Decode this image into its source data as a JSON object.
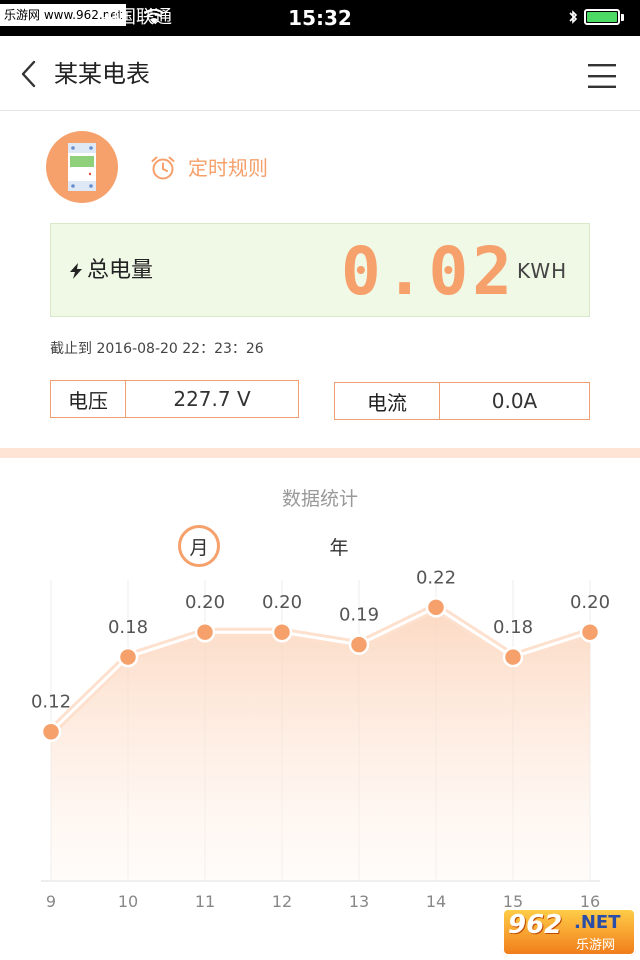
{
  "status_bar": {
    "watermark": "乐游网 www.962.net",
    "carrier": "中国联通",
    "time": "15:32"
  },
  "nav": {
    "title": "某某电表"
  },
  "device": {
    "timer_label": "定时规则"
  },
  "energy": {
    "label": "总电量",
    "value": "0.02",
    "unit": "KWH",
    "timestamp": "截止到 2016-08-20 22：23：26"
  },
  "readings": {
    "voltage_label": "电压",
    "voltage_value": "227.7 V",
    "current_label": "电流",
    "current_value": "0.0A"
  },
  "stats": {
    "title": "数据统计",
    "tab_month": "月",
    "tab_year": "年",
    "selected_tab": "月"
  },
  "chart_data": {
    "type": "area",
    "x": [
      9,
      10,
      11,
      12,
      13,
      14,
      15,
      16
    ],
    "x_labels": [
      "9",
      "10",
      "11",
      "12",
      "13",
      "14",
      "15",
      "16"
    ],
    "values": [
      0.12,
      0.18,
      0.2,
      0.2,
      0.19,
      0.22,
      0.18,
      0.2
    ],
    "data_labels": [
      "0.12",
      "0.18",
      "0.20",
      "0.20",
      "0.19",
      "0.22",
      "0.18",
      "0.20"
    ],
    "title": "",
    "xlabel": "",
    "ylabel": "",
    "ylim": [
      0.0,
      0.25
    ],
    "grid": "vertical",
    "color": "#f6a06b"
  },
  "watermark_logo": {
    "number": "962",
    "net": ".NET",
    "cn": "乐游网"
  },
  "colors": {
    "accent": "#f6a06b",
    "energy_bg": "#f0f8e6",
    "divider": "#fde4d4"
  }
}
